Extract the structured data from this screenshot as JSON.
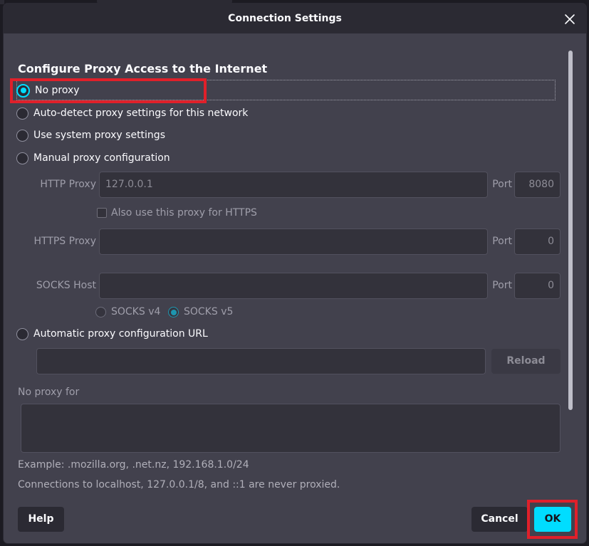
{
  "dialog": {
    "title": "Connection Settings",
    "close_icon": "close-icon"
  },
  "heading": "Configure Proxy Access to the Internet",
  "options": {
    "no_proxy": "No proxy",
    "auto_detect": "Auto-detect proxy settings for this network",
    "system": "Use system proxy settings",
    "manual": "Manual proxy configuration",
    "auto_url": "Automatic proxy configuration URL"
  },
  "manual": {
    "http_label": "HTTP Proxy",
    "http_value": "127.0.0.1",
    "http_port_label": "Port",
    "http_port": "8080",
    "also_https": "Also use this proxy for HTTPS",
    "https_label": "HTTPS Proxy",
    "https_value": "",
    "https_port_label": "Port",
    "https_port": "0",
    "socks_label": "SOCKS Host",
    "socks_value": "",
    "socks_port_label": "Port",
    "socks_port": "0",
    "socks_v4": "SOCKS v4",
    "socks_v5": "SOCKS v5"
  },
  "auto_url": {
    "value": "",
    "reload": "Reload"
  },
  "no_proxy_for": {
    "label": "No proxy for",
    "value": "",
    "example": "Example: .mozilla.org, .net.nz, 192.168.1.0/24",
    "note": "Connections to localhost, 127.0.0.1/8, and ::1 are never proxied."
  },
  "buttons": {
    "help": "Help",
    "cancel": "Cancel",
    "ok": "OK"
  },
  "colors": {
    "accent": "#00ddff",
    "highlight": "#e0202a",
    "dialog_bg": "#42414d"
  }
}
